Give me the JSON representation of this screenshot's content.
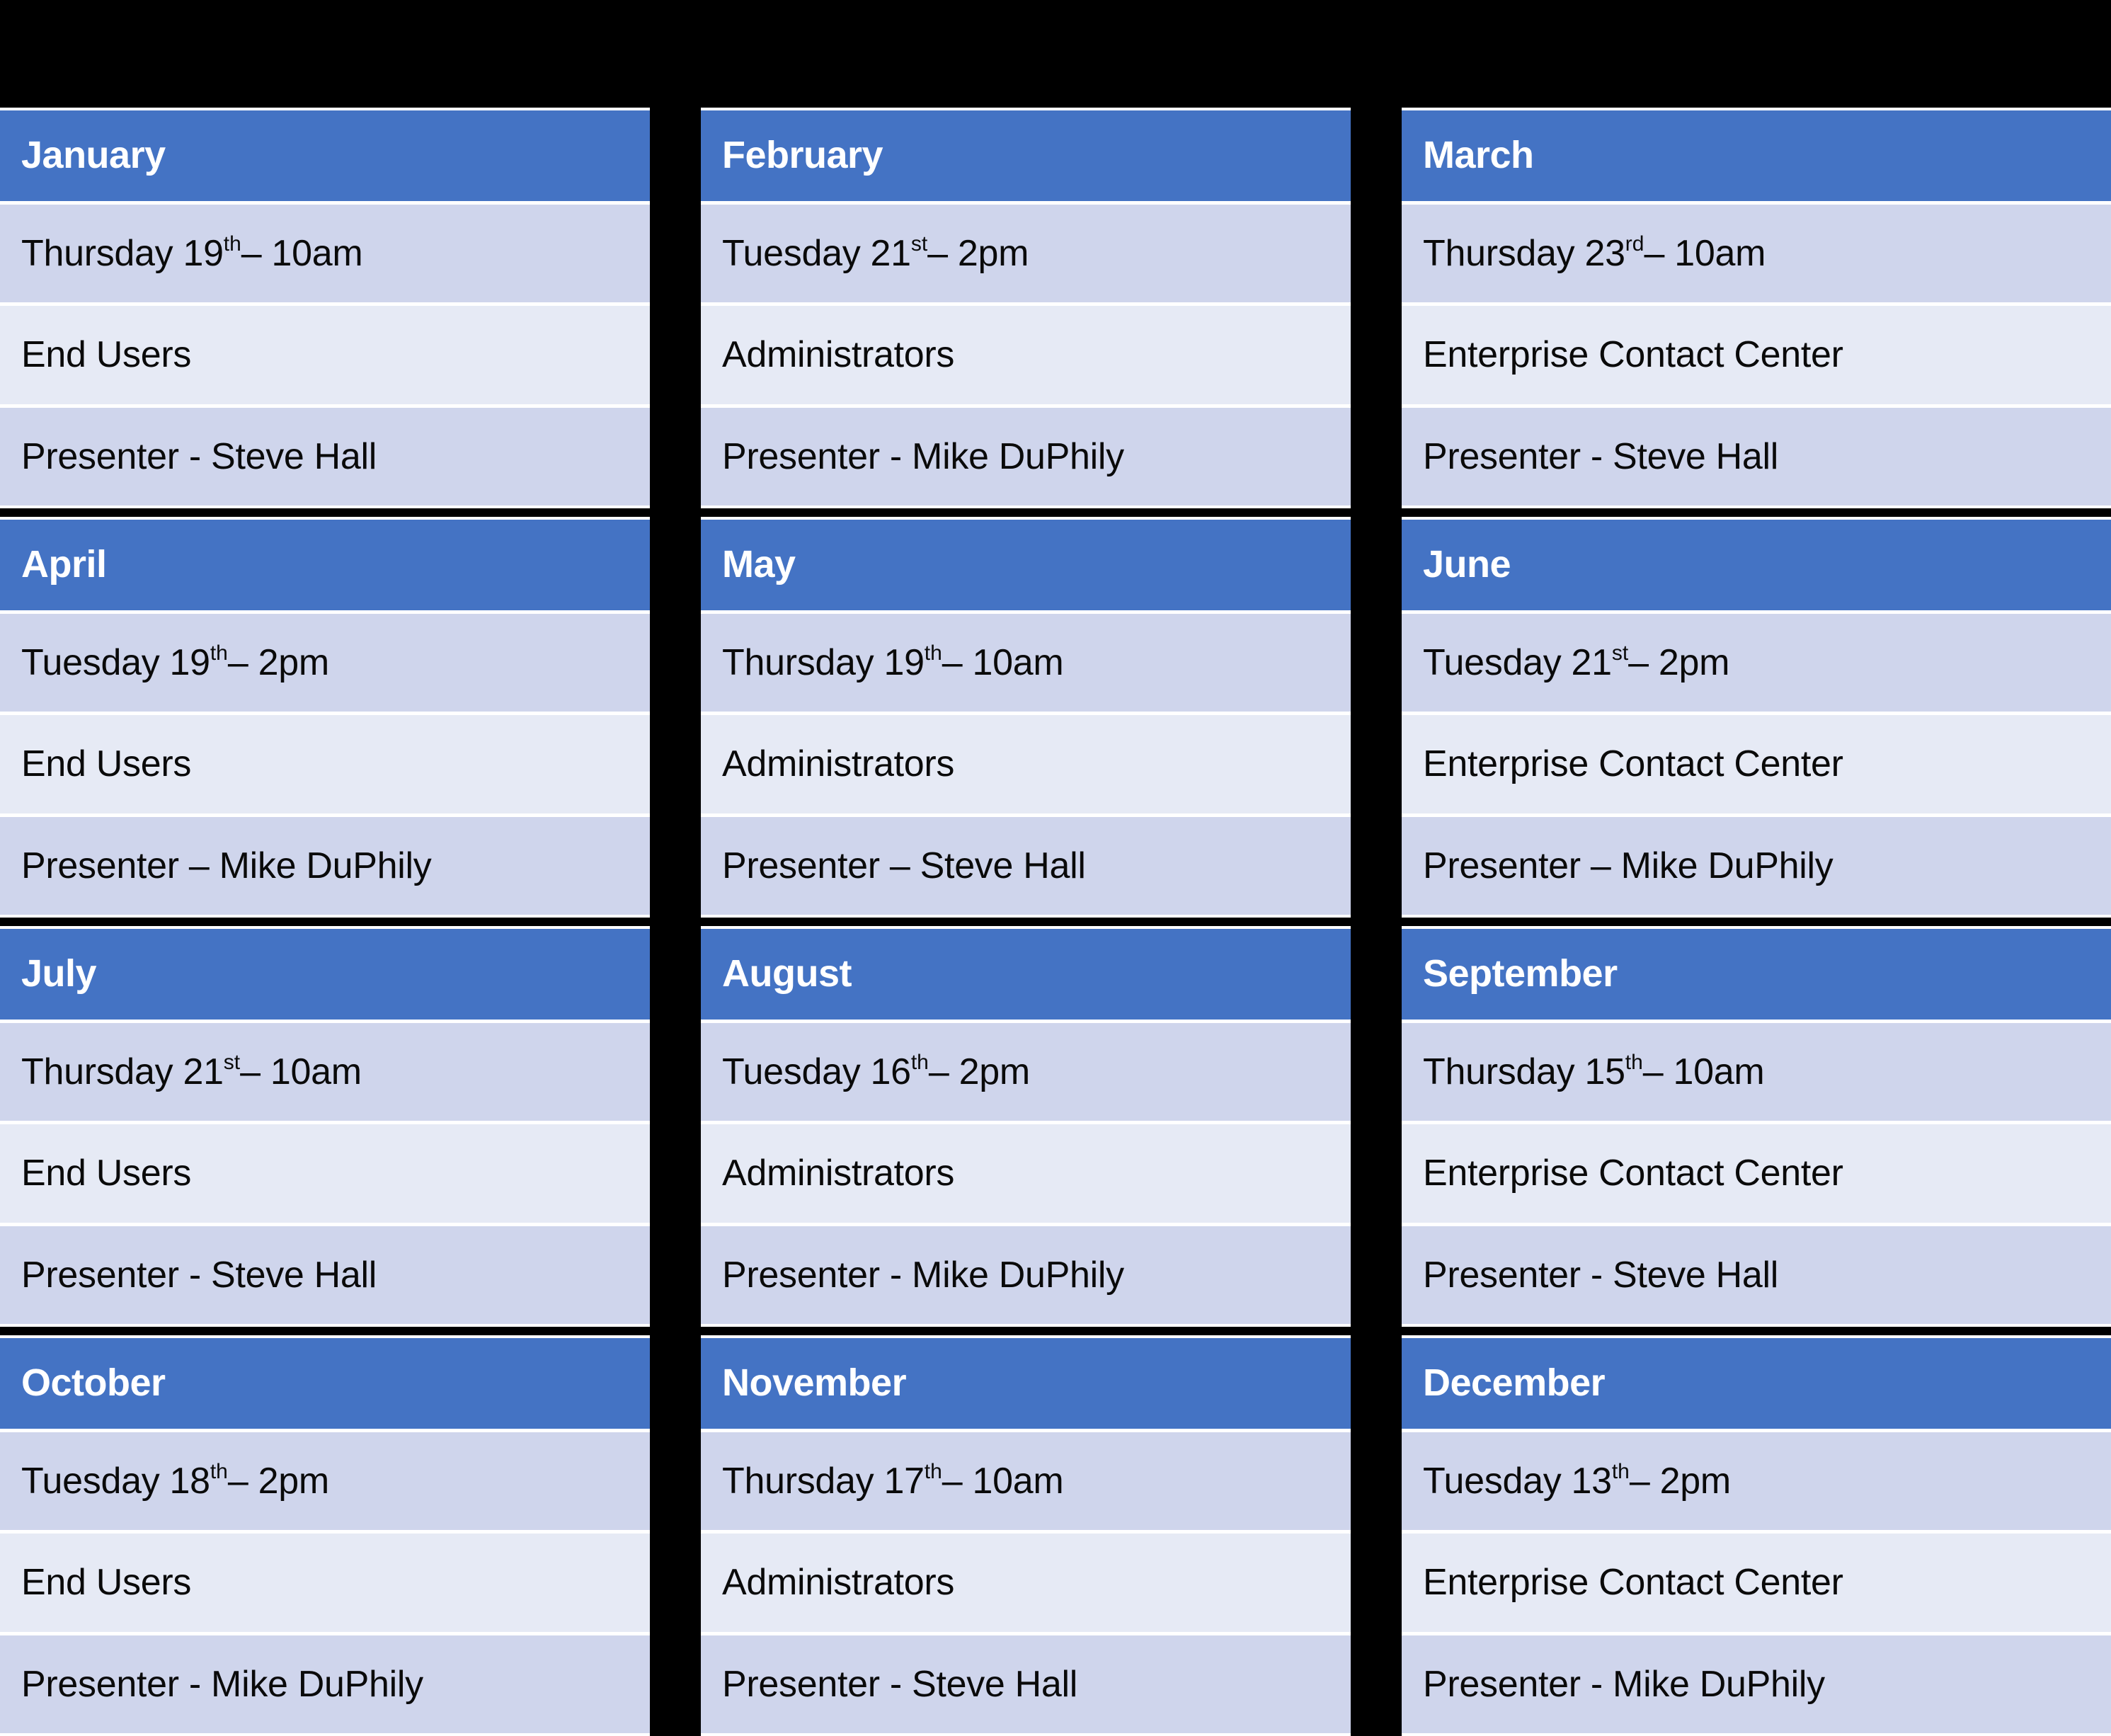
{
  "theme": {
    "background": "#000000",
    "card_background": "#ffffff",
    "header_blue": "#4473C4",
    "row_tone_a": "#CFD5EC",
    "row_tone_b": "#E6EAF5",
    "header_text": "#ffffff",
    "body_text": "#0a0a0a"
  },
  "months": [
    {
      "name": "January",
      "datetime": "Thursday 19",
      "ordinal": "th",
      "datetime_suffix": " – 10am",
      "audience": "End Users",
      "presenter": "Presenter - Steve Hall"
    },
    {
      "name": "February",
      "datetime": "Tuesday 21",
      "ordinal": "st",
      "datetime_suffix": " – 2pm",
      "audience": "Administrators",
      "presenter": "Presenter - Mike DuPhily"
    },
    {
      "name": "March",
      "datetime": "Thursday 23",
      "ordinal": "rd",
      "datetime_suffix": " – 10am",
      "audience": "Enterprise Contact Center",
      "presenter": "Presenter - Steve Hall"
    },
    {
      "name": "April",
      "datetime": "Tuesday 19",
      "ordinal": "th",
      "datetime_suffix": " – 2pm",
      "audience": "End Users",
      "presenter": "Presenter – Mike DuPhily"
    },
    {
      "name": "May",
      "datetime": "Thursday 19",
      "ordinal": "th",
      "datetime_suffix": " – 10am",
      "audience": "Administrators",
      "presenter": "Presenter – Steve Hall"
    },
    {
      "name": "June",
      "datetime": "Tuesday 21",
      "ordinal": "st",
      "datetime_suffix": " – 2pm",
      "audience": "Enterprise Contact Center",
      "presenter": "Presenter – Mike DuPhily"
    },
    {
      "name": "July",
      "datetime": "Thursday 21",
      "ordinal": "st",
      "datetime_suffix": " – 10am",
      "audience": "End Users",
      "presenter": "Presenter - Steve Hall"
    },
    {
      "name": "August",
      "datetime": "Tuesday 16",
      "ordinal": "th",
      "datetime_suffix": " – 2pm",
      "audience": "Administrators",
      "presenter": "Presenter - Mike DuPhily"
    },
    {
      "name": "September",
      "datetime": "Thursday 15",
      "ordinal": "th",
      "datetime_suffix": " – 10am",
      "audience": "Enterprise Contact Center",
      "presenter": "Presenter - Steve Hall"
    },
    {
      "name": "October",
      "datetime": "Tuesday 18",
      "ordinal": "th",
      "datetime_suffix": " – 2pm",
      "audience": "End Users",
      "presenter": "Presenter - Mike DuPhily"
    },
    {
      "name": "November",
      "datetime": "Thursday 17",
      "ordinal": "th",
      "datetime_suffix": " – 10am",
      "audience": "Administrators",
      "presenter": "Presenter - Steve Hall"
    },
    {
      "name": "December",
      "datetime": "Tuesday 13",
      "ordinal": "th",
      "datetime_suffix": " – 2pm",
      "audience": "Enterprise Contact Center",
      "presenter": "Presenter - Mike DuPhily"
    }
  ]
}
